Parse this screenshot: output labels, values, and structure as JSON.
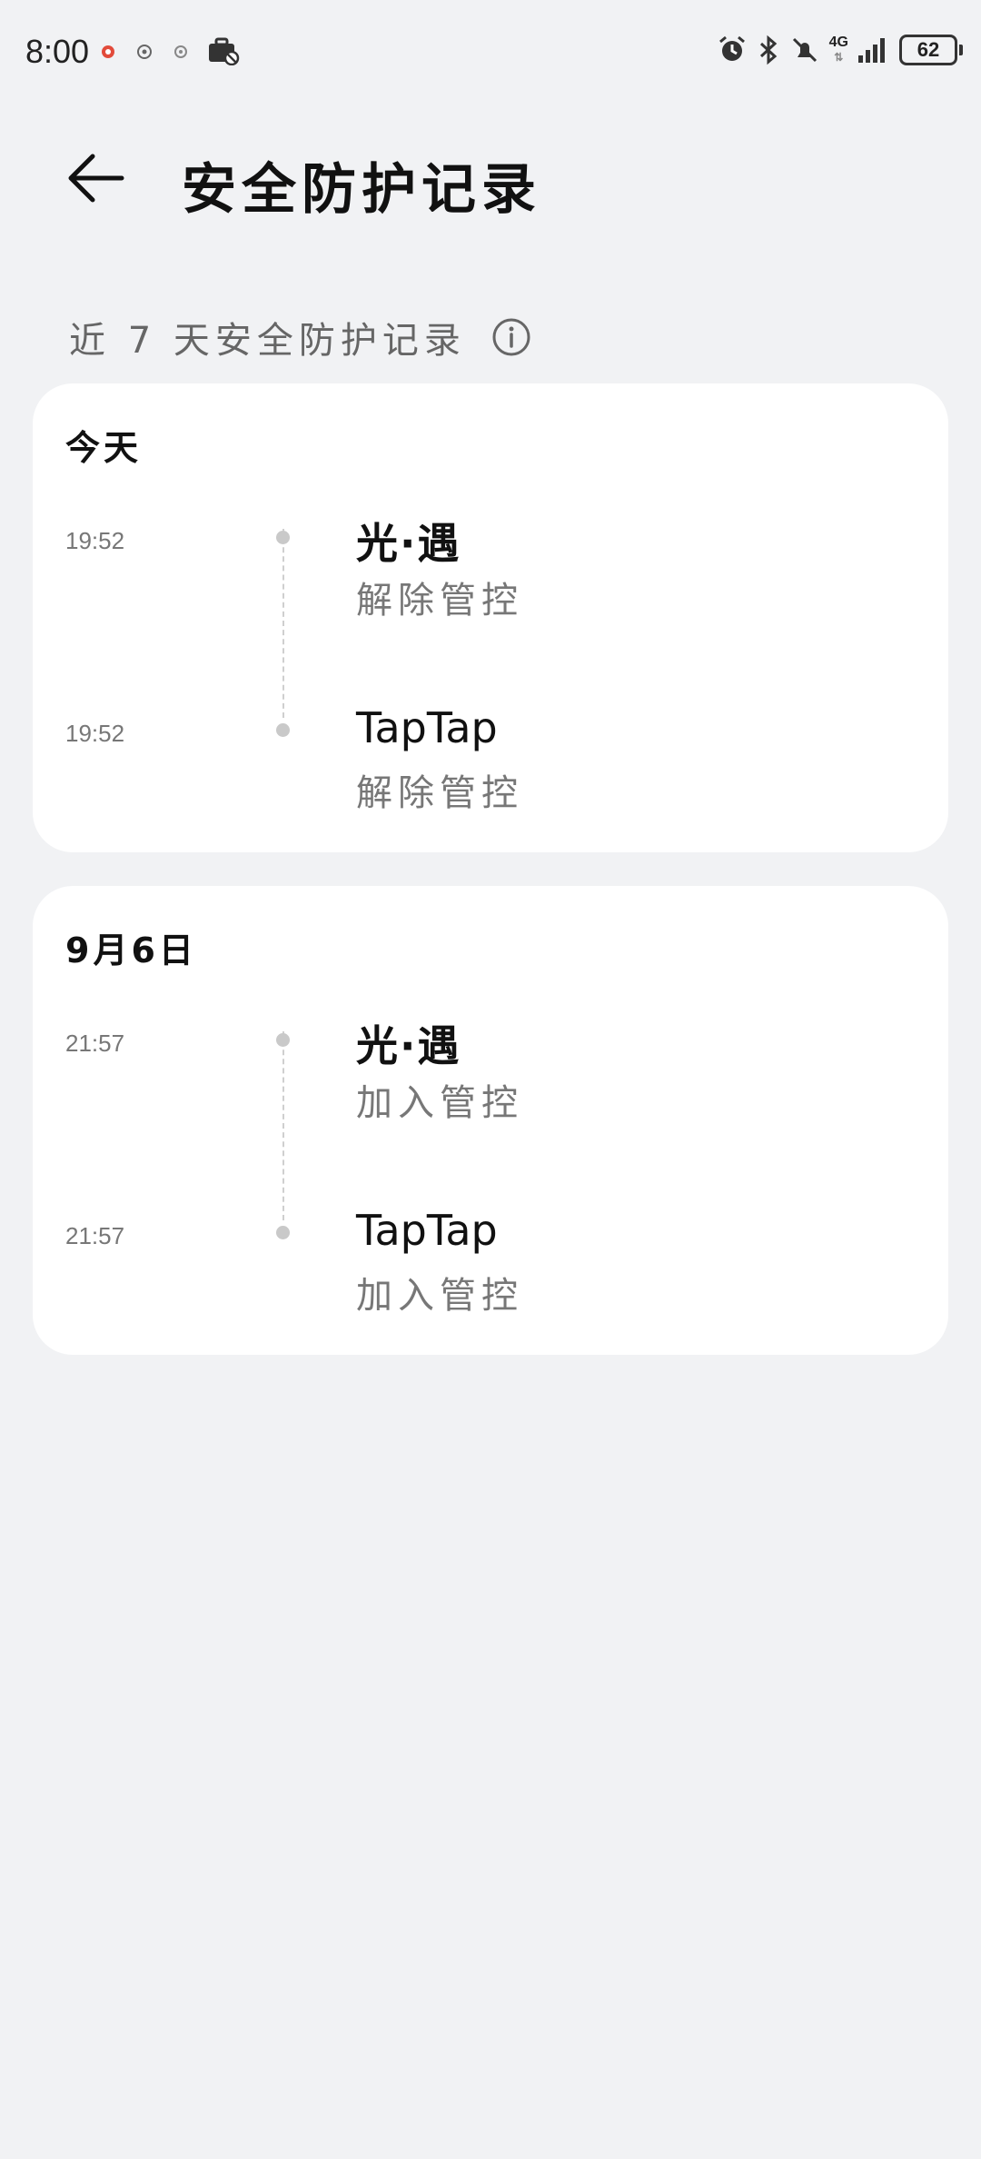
{
  "status_bar": {
    "time": "8:00",
    "left_icons": [
      "notification-icon",
      "notification-icon",
      "notification-icon",
      "briefcase-icon"
    ],
    "right_icons": [
      "alarm-icon",
      "bluetooth-icon",
      "mute-icon",
      "signal-icon"
    ],
    "network": "4G",
    "battery": "62"
  },
  "header": {
    "title": "安全防护记录"
  },
  "section": {
    "label": "近 7 天安全防护记录"
  },
  "groups": [
    {
      "date": "今天",
      "entries": [
        {
          "time": "19:52",
          "app": "光·遇",
          "action": "解除管控"
        },
        {
          "time": "19:52",
          "app": "TapTap",
          "action": "解除管控"
        }
      ]
    },
    {
      "date": "9月6日",
      "entries": [
        {
          "time": "21:57",
          "app": "光·遇",
          "action": "加入管控"
        },
        {
          "time": "21:57",
          "app": "TapTap",
          "action": "加入管控"
        }
      ]
    }
  ]
}
